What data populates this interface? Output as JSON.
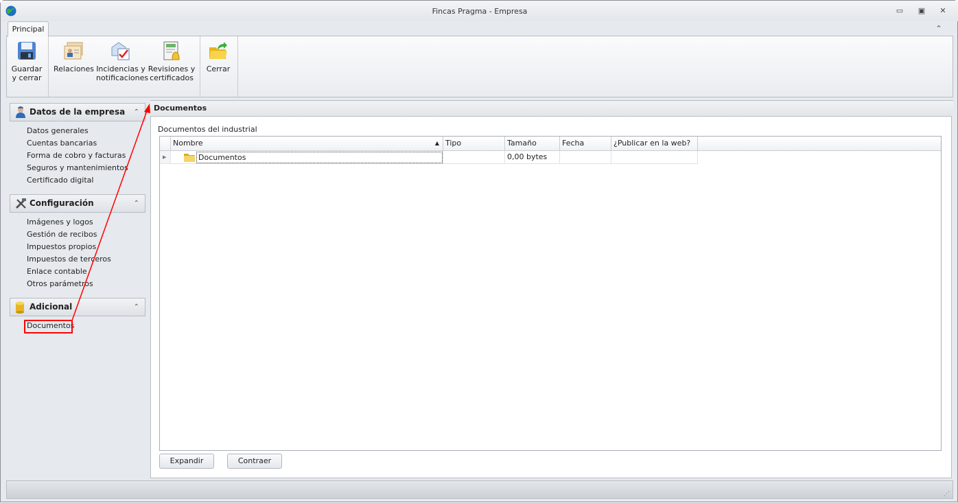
{
  "window": {
    "title": "Fincas Pragma - Empresa",
    "minimize": "▭",
    "restore": "▣",
    "close": "✕",
    "collapse_ribbon": "⌃"
  },
  "ribbon": {
    "tab": "Principal",
    "buttons": [
      {
        "label1": "Guardar",
        "label2": "y cerrar",
        "icon": "save-icon"
      },
      {
        "label1": "Relaciones",
        "label2": "",
        "icon": "contacts-icon"
      },
      {
        "label1": "Incidencias y",
        "label2": "notificaciones",
        "icon": "notification-check-icon"
      },
      {
        "label1": "Revisiones y",
        "label2": "certificados",
        "icon": "ledger-bell-icon"
      },
      {
        "label1": "Cerrar",
        "label2": "",
        "icon": "folder-exit-icon"
      }
    ]
  },
  "sidebar": {
    "groups": [
      {
        "title": "Datos de la empresa",
        "items": [
          "Datos generales",
          "Cuentas bancarias",
          "Forma de cobro y facturas",
          "Seguros y mantenimientos",
          "Certificado digital"
        ]
      },
      {
        "title": "Configuración",
        "items": [
          "Imágenes y logos",
          "Gestión de recibos",
          "Impuestos propios",
          "Impuestos de terceros",
          "Enlace contable",
          "Otros parámetros"
        ]
      },
      {
        "title": "Adicional",
        "items": [
          "Documentos"
        ]
      }
    ]
  },
  "content": {
    "title": "Documentos",
    "section_label": "Documentos del industrial",
    "grid": {
      "columns": [
        "Nombre",
        "Tipo",
        "Tamaño",
        "Fecha",
        "¿Publicar en la web?"
      ],
      "rows": [
        {
          "nombre": "Documentos",
          "tipo": "",
          "tamano": "0,00 bytes",
          "fecha": "",
          "publicar": ""
        }
      ]
    },
    "expand_label": "Expandir",
    "collapse_label": "Contraer"
  },
  "annotation": {
    "color": "#ff0000"
  }
}
